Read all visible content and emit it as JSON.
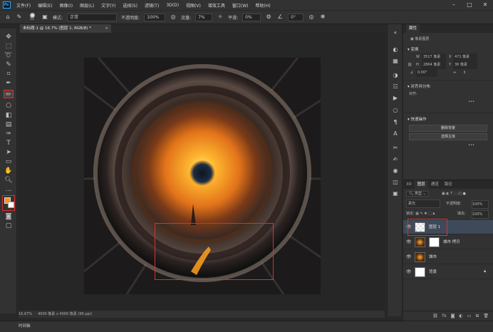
{
  "menubar": {
    "items": [
      "文件(F)",
      "编辑(E)",
      "图像(I)",
      "图层(L)",
      "文字(Y)",
      "选择(S)",
      "滤镜(T)",
      "3D(D)",
      "视图(V)",
      "增效工具",
      "窗口(W)",
      "帮助(H)"
    ]
  },
  "optbar": {
    "brush_size": "51",
    "mode_label": "模式:",
    "mode_value": "正常",
    "opacity_label": "不透明度:",
    "opacity_value": "100%",
    "flow_label": "流量:",
    "flow_value": "7%",
    "smooth_label": "平滑:",
    "smooth_value": "0%",
    "angle_value": "0°"
  },
  "document_tab": {
    "title": "未标题-1 @ 16.7% (图层 1, RGB/8) *",
    "close": "×"
  },
  "status": {
    "zoom": "16.67%",
    "info": "4000 像素 x 4000 像素 (96 ppi)"
  },
  "timeline": {
    "label": "时间轴"
  },
  "properties": {
    "tab": "属性",
    "kind": "像素图层",
    "transform_title": "变换",
    "w_label": "W",
    "w_value": "3517 像素",
    "x_label": "X",
    "x_value": "471 像素",
    "h_label": "H",
    "h_value": "2864 像素",
    "y_label": "Y",
    "y_value": "36 像素",
    "angle": "0.00°",
    "align_title": "对齐并分布",
    "align_label": "对齐:",
    "quick_title": "快速操作",
    "btn_remove_bg": "删除背景",
    "btn_select_subject": "选择主体"
  },
  "layers_panel": {
    "tabs": [
      "3D",
      "图层",
      "通道",
      "路径"
    ],
    "active_tab": "图层",
    "filter_label": "类型",
    "blend_mode": "柔光",
    "opacity_label": "不透明度:",
    "opacity_value": "100%",
    "lock_label": "锁定:",
    "fill_label": "填充:",
    "fill_value": "100%",
    "layers": [
      {
        "name": "图层 1"
      },
      {
        "name": "城市 拷贝"
      },
      {
        "name": "城市"
      },
      {
        "name": "背景"
      }
    ]
  },
  "colors": {
    "accent": "#31a8ff",
    "highlight_box": "#e02d2d",
    "foreground": "#f7941d",
    "background": "#ffffff"
  }
}
